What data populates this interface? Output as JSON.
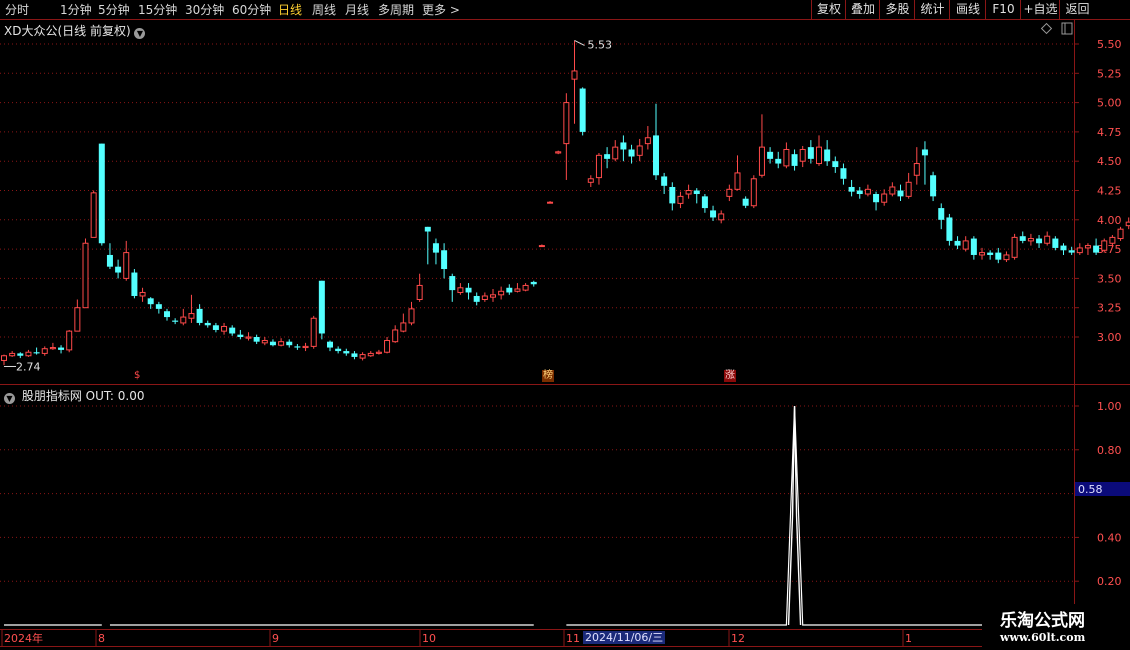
{
  "toolbar": {
    "left_items": [
      "分时",
      "1分钟",
      "5分钟",
      "15分钟",
      "30分钟",
      "60分钟",
      "日线",
      "周线",
      "月线",
      "多周期",
      "更多 >"
    ],
    "active": "日线",
    "right_items": [
      "复权",
      "叠加",
      "多股",
      "统计",
      "画线",
      "F10",
      "+自选",
      "返回"
    ]
  },
  "stock": {
    "title": "XD大众公(日线 前复权)",
    "max_label": "5.53",
    "min_label": "2.74",
    "badges": [
      "$",
      "榜",
      "涨"
    ]
  },
  "indicator": {
    "title": "股朋指标网  OUT: 0.00",
    "cursor_value": "0.58"
  },
  "x_axis": {
    "labels": [
      "2024年",
      "8",
      "9",
      "10",
      "11",
      "12",
      "1"
    ],
    "highlight": "2024/11/06/三"
  },
  "logo": {
    "main": "乐淘公式网",
    "url": "www.60lt.com"
  },
  "colors": {
    "up": "#ff4a4a",
    "down": "#54ffff",
    "grid": "#8a1616",
    "line": "#ffffff",
    "axis_text": "#ff5050"
  },
  "chart_data": [
    {
      "type": "candlestick",
      "y_ticks": [
        3.0,
        3.25,
        3.5,
        3.75,
        4.0,
        4.25,
        4.5,
        4.75,
        5.0,
        5.25,
        5.5
      ],
      "ylim": [
        2.74,
        5.53
      ],
      "candles": [
        [
          2.8,
          2.84,
          2.76,
          2.85
        ],
        [
          2.84,
          2.86,
          2.83,
          2.88
        ],
        [
          2.86,
          2.84,
          2.82,
          2.87
        ],
        [
          2.84,
          2.87,
          2.83,
          2.89
        ],
        [
          2.87,
          2.86,
          2.85,
          2.91
        ],
        [
          2.86,
          2.9,
          2.84,
          2.92
        ],
        [
          2.9,
          2.91,
          2.89,
          2.95
        ],
        [
          2.91,
          2.89,
          2.86,
          2.93
        ],
        [
          2.89,
          3.05,
          2.87,
          3.06
        ],
        [
          3.05,
          3.25,
          3.18,
          3.32
        ],
        [
          3.25,
          3.8,
          3.72,
          3.84
        ],
        [
          3.85,
          4.23,
          4.2,
          4.25
        ],
        [
          4.65,
          3.8,
          3.78,
          4.65
        ],
        [
          3.7,
          3.6,
          3.58,
          3.8
        ],
        [
          3.6,
          3.55,
          3.5,
          3.66
        ],
        [
          3.5,
          3.72,
          3.48,
          3.82
        ],
        [
          3.55,
          3.35,
          3.33,
          3.58
        ],
        [
          3.35,
          3.38,
          3.3,
          3.42
        ],
        [
          3.33,
          3.28,
          3.24,
          3.34
        ],
        [
          3.28,
          3.24,
          3.2,
          3.3
        ],
        [
          3.22,
          3.17,
          3.14,
          3.24
        ],
        [
          3.14,
          3.13,
          3.11,
          3.16
        ],
        [
          3.12,
          3.17,
          3.1,
          3.24
        ],
        [
          3.16,
          3.2,
          3.12,
          3.36
        ],
        [
          3.24,
          3.12,
          3.1,
          3.28
        ],
        [
          3.12,
          3.1,
          3.08,
          3.14
        ],
        [
          3.1,
          3.06,
          3.04,
          3.12
        ],
        [
          3.05,
          3.09,
          3.02,
          3.12
        ],
        [
          3.08,
          3.03,
          3.01,
          3.1
        ],
        [
          3.02,
          3.0,
          2.98,
          3.06
        ],
        [
          2.99,
          3.0,
          2.97,
          3.04
        ],
        [
          3.0,
          2.96,
          2.94,
          3.02
        ],
        [
          2.95,
          2.97,
          2.93,
          3.0
        ],
        [
          2.96,
          2.93,
          2.92,
          2.98
        ],
        [
          2.93,
          2.96,
          2.92,
          2.99
        ],
        [
          2.96,
          2.93,
          2.91,
          2.98
        ],
        [
          2.92,
          2.91,
          2.89,
          2.94
        ],
        [
          2.91,
          2.92,
          2.88,
          2.95
        ],
        [
          2.92,
          3.16,
          2.9,
          3.18
        ],
        [
          3.48,
          3.03,
          2.98,
          3.48
        ],
        [
          2.96,
          2.91,
          2.88,
          2.97
        ],
        [
          2.9,
          2.88,
          2.86,
          2.92
        ],
        [
          2.88,
          2.86,
          2.84,
          2.9
        ],
        [
          2.86,
          2.83,
          2.81,
          2.88
        ],
        [
          2.82,
          2.85,
          2.8,
          2.87
        ],
        [
          2.84,
          2.86,
          2.83,
          2.88
        ],
        [
          2.86,
          2.87,
          2.85,
          2.89
        ],
        [
          2.87,
          2.97,
          2.86,
          3.0
        ],
        [
          2.96,
          3.06,
          2.95,
          3.1
        ],
        [
          3.05,
          3.12,
          3.04,
          3.2
        ],
        [
          3.12,
          3.24,
          3.1,
          3.3
        ],
        [
          3.32,
          3.44,
          3.3,
          3.54
        ],
        [
          3.94,
          3.9,
          3.62,
          3.94
        ],
        [
          3.8,
          3.72,
          3.62,
          3.84
        ],
        [
          3.74,
          3.58,
          3.5,
          3.8
        ],
        [
          3.52,
          3.4,
          3.3,
          3.54
        ],
        [
          3.38,
          3.42,
          3.36,
          3.46
        ],
        [
          3.42,
          3.38,
          3.32,
          3.46
        ],
        [
          3.35,
          3.3,
          3.27,
          3.38
        ],
        [
          3.32,
          3.35,
          3.3,
          3.38
        ],
        [
          3.34,
          3.36,
          3.3,
          3.41
        ],
        [
          3.36,
          3.39,
          3.32,
          3.43
        ],
        [
          3.42,
          3.38,
          3.36,
          3.45
        ],
        [
          3.39,
          3.41,
          3.38,
          3.46
        ],
        [
          3.4,
          3.44,
          3.39,
          3.46
        ],
        [
          3.47,
          3.45,
          3.43,
          3.48
        ],
        [
          3.78,
          3.78,
          3.77,
          3.79
        ],
        [
          4.15,
          4.15,
          4.14,
          4.16
        ],
        [
          4.57,
          4.58,
          4.56,
          4.59
        ],
        [
          4.65,
          5.0,
          4.34,
          5.08
        ],
        [
          5.2,
          5.27,
          4.82,
          5.53
        ],
        [
          5.12,
          4.75,
          4.72,
          5.13
        ],
        [
          4.32,
          4.35,
          4.28,
          4.38
        ],
        [
          4.36,
          4.55,
          4.3,
          4.57
        ],
        [
          4.56,
          4.52,
          4.44,
          4.62
        ],
        [
          4.52,
          4.62,
          4.5,
          4.68
        ],
        [
          4.66,
          4.6,
          4.5,
          4.72
        ],
        [
          4.6,
          4.54,
          4.48,
          4.64
        ],
        [
          4.55,
          4.63,
          4.5,
          4.69
        ],
        [
          4.65,
          4.7,
          4.6,
          4.8
        ],
        [
          4.72,
          4.38,
          4.34,
          4.99
        ],
        [
          4.37,
          4.29,
          4.22,
          4.4
        ],
        [
          4.28,
          4.14,
          4.08,
          4.32
        ],
        [
          4.14,
          4.2,
          4.1,
          4.24
        ],
        [
          4.22,
          4.25,
          4.18,
          4.3
        ],
        [
          4.25,
          4.22,
          4.14,
          4.27
        ],
        [
          4.2,
          4.1,
          4.06,
          4.22
        ],
        [
          4.08,
          4.02,
          3.99,
          4.12
        ],
        [
          4.0,
          4.05,
          3.97,
          4.08
        ],
        [
          4.2,
          4.26,
          4.16,
          4.3
        ],
        [
          4.26,
          4.4,
          4.25,
          4.55
        ],
        [
          4.18,
          4.12,
          4.1,
          4.2
        ],
        [
          4.12,
          4.35,
          4.1,
          4.38
        ],
        [
          4.38,
          4.62,
          4.36,
          4.9
        ],
        [
          4.58,
          4.52,
          4.48,
          4.62
        ],
        [
          4.52,
          4.48,
          4.44,
          4.58
        ],
        [
          4.46,
          4.6,
          4.44,
          4.66
        ],
        [
          4.56,
          4.46,
          4.42,
          4.6
        ],
        [
          4.5,
          4.6,
          4.45,
          4.63
        ],
        [
          4.62,
          4.52,
          4.48,
          4.68
        ],
        [
          4.48,
          4.62,
          4.46,
          4.72
        ],
        [
          4.6,
          4.5,
          4.46,
          4.68
        ],
        [
          4.5,
          4.45,
          4.4,
          4.54
        ],
        [
          4.44,
          4.35,
          4.3,
          4.48
        ],
        [
          4.28,
          4.24,
          4.2,
          4.34
        ],
        [
          4.25,
          4.22,
          4.18,
          4.28
        ],
        [
          4.22,
          4.26,
          4.2,
          4.3
        ],
        [
          4.22,
          4.15,
          4.08,
          4.24
        ],
        [
          4.15,
          4.22,
          4.12,
          4.26
        ],
        [
          4.22,
          4.28,
          4.2,
          4.32
        ],
        [
          4.25,
          4.2,
          4.16,
          4.3
        ],
        [
          4.2,
          4.32,
          4.18,
          4.4
        ],
        [
          4.38,
          4.48,
          4.3,
          4.62
        ],
        [
          4.6,
          4.55,
          4.3,
          4.67
        ],
        [
          4.38,
          4.2,
          4.16,
          4.41
        ],
        [
          4.1,
          4.0,
          3.92,
          4.14
        ],
        [
          4.02,
          3.82,
          3.78,
          4.05
        ],
        [
          3.82,
          3.78,
          3.75,
          3.86
        ],
        [
          3.75,
          3.82,
          3.73,
          3.86
        ],
        [
          3.84,
          3.7,
          3.66,
          3.86
        ],
        [
          3.7,
          3.72,
          3.66,
          3.76
        ],
        [
          3.72,
          3.7,
          3.66,
          3.74
        ],
        [
          3.72,
          3.66,
          3.63,
          3.76
        ],
        [
          3.66,
          3.7,
          3.64,
          3.73
        ],
        [
          3.68,
          3.85,
          3.66,
          3.88
        ],
        [
          3.86,
          3.82,
          3.8,
          3.9
        ],
        [
          3.82,
          3.84,
          3.78,
          3.88
        ],
        [
          3.84,
          3.8,
          3.76,
          3.87
        ],
        [
          3.8,
          3.86,
          3.78,
          3.9
        ],
        [
          3.84,
          3.76,
          3.74,
          3.86
        ],
        [
          3.78,
          3.74,
          3.7,
          3.8
        ],
        [
          3.74,
          3.72,
          3.7,
          3.77
        ],
        [
          3.72,
          3.76,
          3.7,
          3.8
        ],
        [
          3.76,
          3.78,
          3.7,
          3.8
        ],
        [
          3.78,
          3.72,
          3.7,
          3.84
        ],
        [
          3.74,
          3.82,
          3.72,
          3.84
        ],
        [
          3.8,
          3.85,
          3.77,
          3.87
        ],
        [
          3.84,
          3.92,
          3.82,
          3.94
        ],
        [
          3.95,
          3.98,
          3.92,
          4.02
        ],
        [
          3.98,
          4.02,
          3.96,
          4.04
        ]
      ]
    },
    {
      "type": "line",
      "name": "OUT",
      "y_ticks": [
        0.2,
        0.4,
        0.6,
        0.8,
        1.0
      ],
      "ylim": [
        0,
        1.0
      ],
      "segments": [
        [
          0,
          12
        ],
        [
          13,
          65
        ],
        [
          69,
          130
        ]
      ],
      "spike_index": 97,
      "spike_value": 1.0
    }
  ]
}
